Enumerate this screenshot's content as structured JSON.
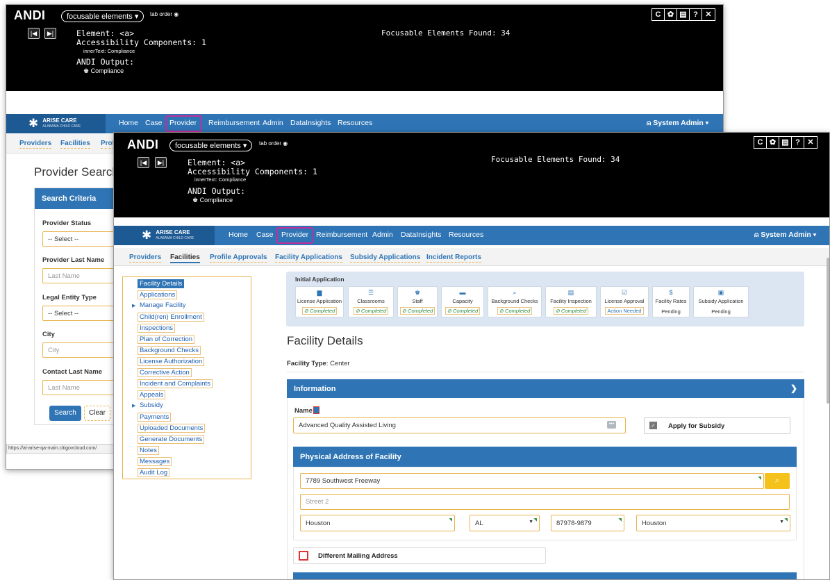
{
  "andi": {
    "title": "ANDI",
    "mode": "focusable elements",
    "tab_order": "tab order",
    "prev": "|◀",
    "next": "▶|",
    "element": "Element: <a>",
    "acc_components": "Accessibility Components: 1",
    "inner_text": "innerText: Compliance",
    "output_label": "ANDI Output:",
    "output_value": "Compliance",
    "found": "Focusable Elements Found: 34",
    "tools": [
      "C",
      "✿",
      "▤",
      "?",
      "✕"
    ]
  },
  "nav": {
    "logo": "ARISE CARE",
    "logo_sub": "ALABAMA CHILD CARE",
    "items": [
      "Home",
      "Case",
      "Provider",
      "Reimbursement",
      "Admin",
      "DataInsights",
      "Resources"
    ],
    "user": "System Admin"
  },
  "back": {
    "subtabs": [
      "Providers",
      "Facilities",
      "Prof"
    ],
    "page_title": "Provider Search",
    "criteria_title": "Search Criteria",
    "status_label": "Provider Status",
    "status_value": "-- Select --",
    "lastname_label": "Provider Last Name",
    "lastname_ph": "Last Name",
    "entity_label": "Legal Entity Type",
    "entity_value": "-- Select --",
    "city_label": "City",
    "city_ph": "City",
    "contact_label": "Contact Last Name",
    "contact_ph": "Last Name",
    "search_btn": "Search",
    "clear_btn": "Clear",
    "status_url": "https://al-arise-qa-main.citigovcloud.com/"
  },
  "front": {
    "subtabs": [
      "Providers",
      "Facilities",
      "Profile Approvals",
      "Facility Applications",
      "Subsidy Applications",
      "Incident Reports"
    ],
    "sidebar": [
      "Facility Details",
      "Applications",
      "Manage Facility",
      "Child(ren) Enrollment",
      "Inspections",
      "Plan of Correction",
      "Background Checks",
      "License Authorization",
      "Corrective Action",
      "Incident and Complaints",
      "Appeals",
      "Subsidy",
      "Payments",
      "Uploaded Documents",
      "Generate Documents",
      "Notes",
      "Messages",
      "Audit Log"
    ],
    "initial_app": "Initial Application",
    "steps": [
      {
        "name": "License Application",
        "status": "Completed",
        "kind": "done",
        "icon": "▆"
      },
      {
        "name": "Classrooms",
        "status": "Completed",
        "kind": "done",
        "icon": "☰"
      },
      {
        "name": "Staff",
        "status": "Completed",
        "kind": "done",
        "icon": "♚"
      },
      {
        "name": "Capacity",
        "status": "Completed",
        "kind": "done",
        "icon": "▬"
      },
      {
        "name": "Background Checks",
        "status": "Completed",
        "kind": "done",
        "icon": "⌕"
      },
      {
        "name": "Facility Inspection",
        "status": "Completed",
        "kind": "done",
        "icon": "▤"
      },
      {
        "name": "License Approval",
        "status": "Action Needed",
        "kind": "need",
        "icon": "☑"
      },
      {
        "name": "Facility Rates",
        "status": "Pending",
        "kind": "pend",
        "icon": "$"
      },
      {
        "name": "Subsidy Application",
        "status": "Pending",
        "kind": "pend",
        "icon": "▣"
      }
    ],
    "completed_prefix": "⊘",
    "page_title": "Facility Details",
    "facility_type_label": "Facility Type",
    "facility_type_value": "Center",
    "info_header": "Information",
    "name_label": "Name",
    "name_value": "Advanced Quality Assisted Living",
    "apply_subsidy": "Apply for Subsidy",
    "phys_header": "Physical Address of Facility",
    "street1": "7789 Southwest Freeway",
    "street2_ph": "Street 2",
    "city": "Houston",
    "state": "AL",
    "zip": "87978-9879",
    "county": "Houston",
    "diff_mailing": "Different Mailing Address"
  },
  "colors": {
    "accent": "#2f75b5",
    "highlight": "#c02e9c",
    "focus": "#e8b34b"
  }
}
